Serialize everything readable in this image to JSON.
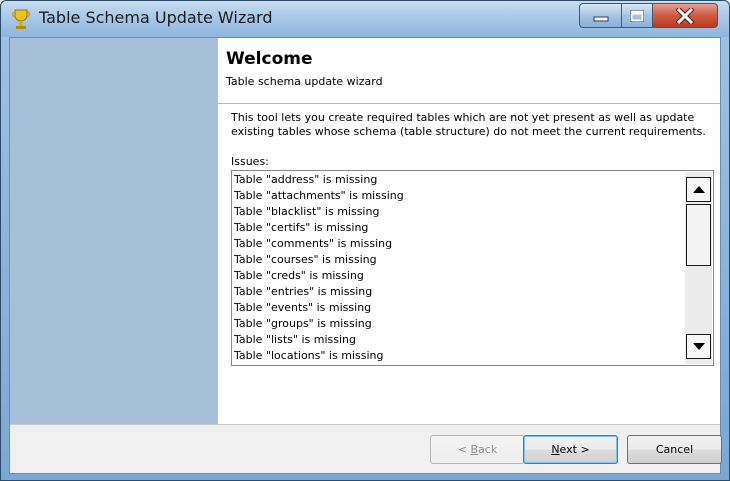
{
  "window": {
    "title": "Table Schema Update Wizard",
    "icon": "trophy-icon",
    "controls": {
      "minimize_icon": "minimize-icon",
      "maximize_icon": "maximize-icon",
      "close_icon": "close-icon"
    }
  },
  "page": {
    "heading": "Welcome",
    "subheading": "Table schema update wizard",
    "description": "This tool lets you create required tables which are not yet present as well as update existing tables whose schema (table structure) do not meet the current requirements.",
    "issues_label": "Issues:"
  },
  "issues": [
    "Table \"address\" is missing",
    "Table \"attachments\" is missing",
    "Table \"blacklist\" is missing",
    "Table \"certifs\" is missing",
    "Table \"comments\" is missing",
    "Table \"courses\" is missing",
    "Table \"creds\" is missing",
    "Table \"entries\" is missing",
    "Table \"events\" is missing",
    "Table \"groups\" is missing",
    "Table \"lists\" is missing",
    "Table \"locations\" is missing"
  ],
  "scroll": {
    "up_icon": "scroll-up-arrow-icon",
    "down_icon": "scroll-down-arrow-icon"
  },
  "buttons": {
    "back_prefix": "< ",
    "back_access": "B",
    "back_rest": "ack",
    "next_access": "N",
    "next_rest": "ext >",
    "cancel": "Cancel"
  },
  "colors": {
    "side_panel": "#a7bfd9",
    "close_button": "#cf5a43"
  }
}
